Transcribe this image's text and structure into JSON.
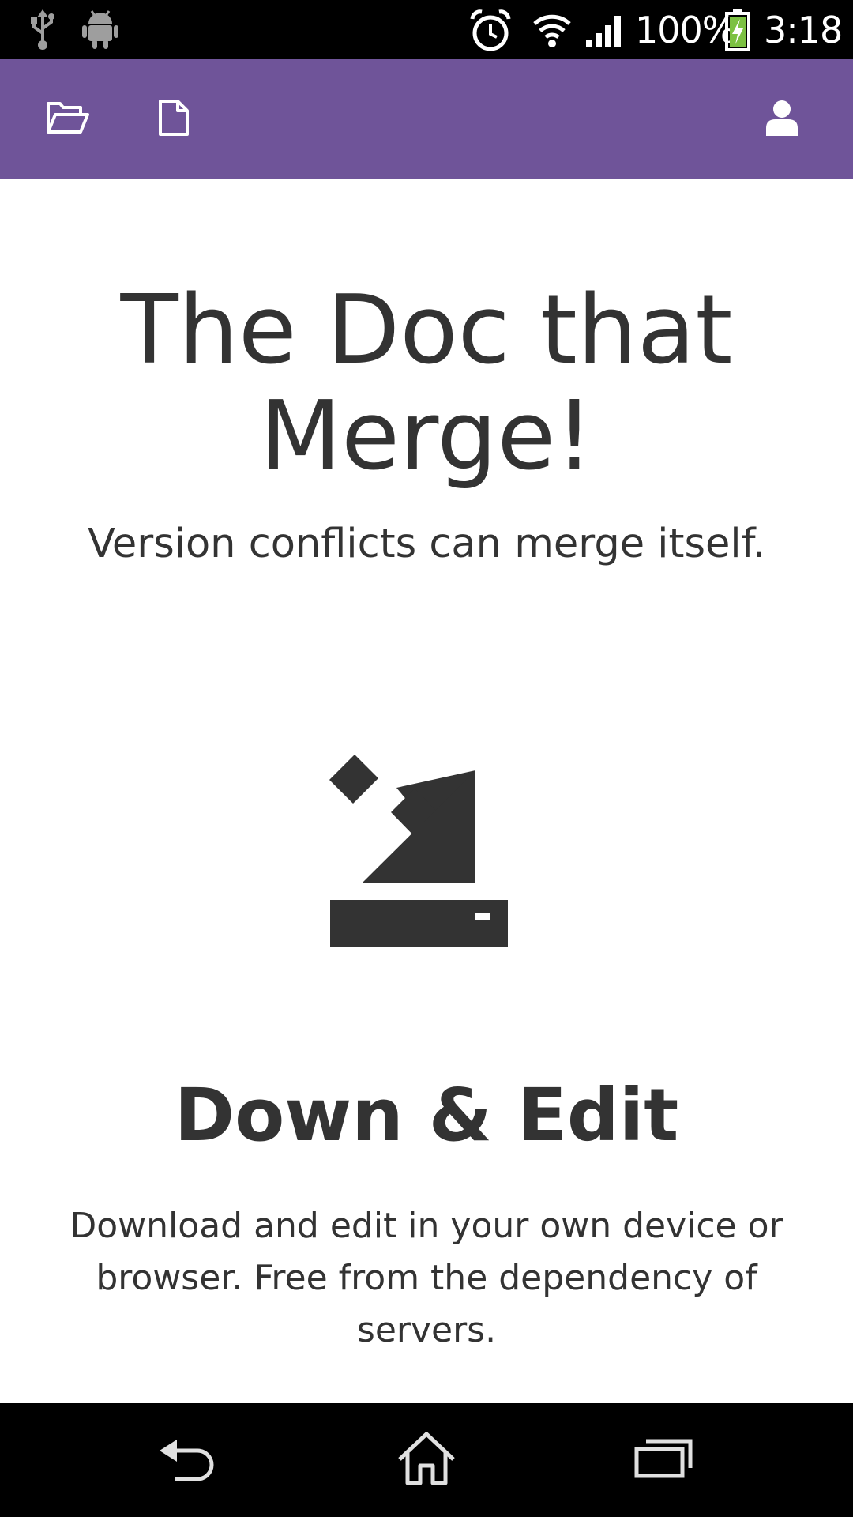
{
  "status_bar": {
    "battery_percent": "100%",
    "time": "3:18",
    "icons": [
      "usb-icon",
      "android-icon",
      "alarm-icon",
      "wifi-icon",
      "signal-icon",
      "battery-charging-icon"
    ]
  },
  "app_bar": {
    "background": "#6f5499",
    "icons": [
      "open-folder-icon",
      "new-file-icon",
      "user-icon"
    ]
  },
  "hero": {
    "title": "The Doc that Merge!",
    "subtitle": "Version conflicts can merge itself."
  },
  "feature": {
    "icon": "download-to-drive-icon",
    "title": "Down & Edit",
    "description": "Download and edit in your own device or browser. Free from the dependency of servers."
  },
  "nav_bar": {
    "icons": [
      "back-icon",
      "home-icon",
      "recent-apps-icon"
    ]
  }
}
